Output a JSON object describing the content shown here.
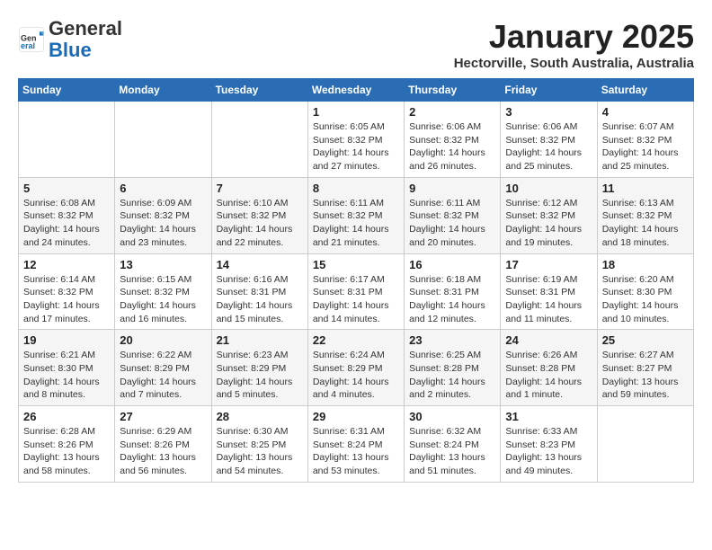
{
  "header": {
    "logo_general": "General",
    "logo_blue": "Blue",
    "month_title": "January 2025",
    "subtitle": "Hectorville, South Australia, Australia"
  },
  "weekdays": [
    "Sunday",
    "Monday",
    "Tuesday",
    "Wednesday",
    "Thursday",
    "Friday",
    "Saturday"
  ],
  "weeks": [
    [
      {
        "day": "",
        "info": ""
      },
      {
        "day": "",
        "info": ""
      },
      {
        "day": "",
        "info": ""
      },
      {
        "day": "1",
        "info": "Sunrise: 6:05 AM\nSunset: 8:32 PM\nDaylight: 14 hours\nand 27 minutes."
      },
      {
        "day": "2",
        "info": "Sunrise: 6:06 AM\nSunset: 8:32 PM\nDaylight: 14 hours\nand 26 minutes."
      },
      {
        "day": "3",
        "info": "Sunrise: 6:06 AM\nSunset: 8:32 PM\nDaylight: 14 hours\nand 25 minutes."
      },
      {
        "day": "4",
        "info": "Sunrise: 6:07 AM\nSunset: 8:32 PM\nDaylight: 14 hours\nand 25 minutes."
      }
    ],
    [
      {
        "day": "5",
        "info": "Sunrise: 6:08 AM\nSunset: 8:32 PM\nDaylight: 14 hours\nand 24 minutes."
      },
      {
        "day": "6",
        "info": "Sunrise: 6:09 AM\nSunset: 8:32 PM\nDaylight: 14 hours\nand 23 minutes."
      },
      {
        "day": "7",
        "info": "Sunrise: 6:10 AM\nSunset: 8:32 PM\nDaylight: 14 hours\nand 22 minutes."
      },
      {
        "day": "8",
        "info": "Sunrise: 6:11 AM\nSunset: 8:32 PM\nDaylight: 14 hours\nand 21 minutes."
      },
      {
        "day": "9",
        "info": "Sunrise: 6:11 AM\nSunset: 8:32 PM\nDaylight: 14 hours\nand 20 minutes."
      },
      {
        "day": "10",
        "info": "Sunrise: 6:12 AM\nSunset: 8:32 PM\nDaylight: 14 hours\nand 19 minutes."
      },
      {
        "day": "11",
        "info": "Sunrise: 6:13 AM\nSunset: 8:32 PM\nDaylight: 14 hours\nand 18 minutes."
      }
    ],
    [
      {
        "day": "12",
        "info": "Sunrise: 6:14 AM\nSunset: 8:32 PM\nDaylight: 14 hours\nand 17 minutes."
      },
      {
        "day": "13",
        "info": "Sunrise: 6:15 AM\nSunset: 8:32 PM\nDaylight: 14 hours\nand 16 minutes."
      },
      {
        "day": "14",
        "info": "Sunrise: 6:16 AM\nSunset: 8:31 PM\nDaylight: 14 hours\nand 15 minutes."
      },
      {
        "day": "15",
        "info": "Sunrise: 6:17 AM\nSunset: 8:31 PM\nDaylight: 14 hours\nand 14 minutes."
      },
      {
        "day": "16",
        "info": "Sunrise: 6:18 AM\nSunset: 8:31 PM\nDaylight: 14 hours\nand 12 minutes."
      },
      {
        "day": "17",
        "info": "Sunrise: 6:19 AM\nSunset: 8:31 PM\nDaylight: 14 hours\nand 11 minutes."
      },
      {
        "day": "18",
        "info": "Sunrise: 6:20 AM\nSunset: 8:30 PM\nDaylight: 14 hours\nand 10 minutes."
      }
    ],
    [
      {
        "day": "19",
        "info": "Sunrise: 6:21 AM\nSunset: 8:30 PM\nDaylight: 14 hours\nand 8 minutes."
      },
      {
        "day": "20",
        "info": "Sunrise: 6:22 AM\nSunset: 8:29 PM\nDaylight: 14 hours\nand 7 minutes."
      },
      {
        "day": "21",
        "info": "Sunrise: 6:23 AM\nSunset: 8:29 PM\nDaylight: 14 hours\nand 5 minutes."
      },
      {
        "day": "22",
        "info": "Sunrise: 6:24 AM\nSunset: 8:29 PM\nDaylight: 14 hours\nand 4 minutes."
      },
      {
        "day": "23",
        "info": "Sunrise: 6:25 AM\nSunset: 8:28 PM\nDaylight: 14 hours\nand 2 minutes."
      },
      {
        "day": "24",
        "info": "Sunrise: 6:26 AM\nSunset: 8:28 PM\nDaylight: 14 hours\nand 1 minute."
      },
      {
        "day": "25",
        "info": "Sunrise: 6:27 AM\nSunset: 8:27 PM\nDaylight: 13 hours\nand 59 minutes."
      }
    ],
    [
      {
        "day": "26",
        "info": "Sunrise: 6:28 AM\nSunset: 8:26 PM\nDaylight: 13 hours\nand 58 minutes."
      },
      {
        "day": "27",
        "info": "Sunrise: 6:29 AM\nSunset: 8:26 PM\nDaylight: 13 hours\nand 56 minutes."
      },
      {
        "day": "28",
        "info": "Sunrise: 6:30 AM\nSunset: 8:25 PM\nDaylight: 13 hours\nand 54 minutes."
      },
      {
        "day": "29",
        "info": "Sunrise: 6:31 AM\nSunset: 8:24 PM\nDaylight: 13 hours\nand 53 minutes."
      },
      {
        "day": "30",
        "info": "Sunrise: 6:32 AM\nSunset: 8:24 PM\nDaylight: 13 hours\nand 51 minutes."
      },
      {
        "day": "31",
        "info": "Sunrise: 6:33 AM\nSunset: 8:23 PM\nDaylight: 13 hours\nand 49 minutes."
      },
      {
        "day": "",
        "info": ""
      }
    ]
  ]
}
